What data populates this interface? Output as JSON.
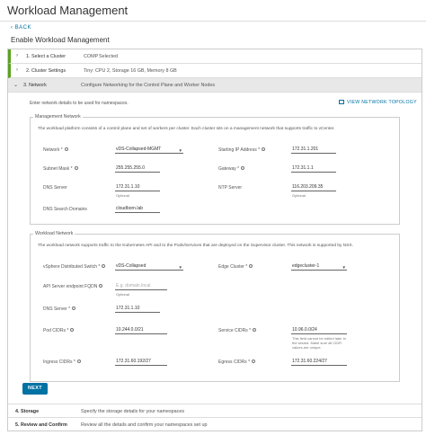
{
  "window": {
    "title": "Workload Management"
  },
  "nav": {
    "back_label": "BACK"
  },
  "page": {
    "title": "Enable Workload Management"
  },
  "steps": [
    {
      "name": "1. Select a Cluster",
      "desc": "COMP",
      "desc2": "Selected",
      "state": "done"
    },
    {
      "name": "2. Cluster Settings",
      "desc": "Tiny: CPU 2, Storage 16 GB, Memory 8 GB",
      "state": "done"
    },
    {
      "name": "3. Network",
      "desc": "Configure Networking for the Control Plane and Worker Nodes",
      "state": "active"
    },
    {
      "name": "4. Storage",
      "desc": "Specify the storage details for your namespaces",
      "state": "pending"
    },
    {
      "name": "5. Review and Confirm",
      "desc": "Review all the details and confirm your namespaces set up",
      "state": "pending"
    }
  ],
  "network": {
    "intro": "Enter network details to be used for namespaces.",
    "topology_link": "VIEW NETWORK TOPOLOGY",
    "management": {
      "legend": "Management Network",
      "description": "The workload platform consists of a control plane and set of workers per cluster. Each cluster sits on a management network that supports traffic to vCenter.",
      "network_label": "Network",
      "network_value": "vDS-Collapsed-MGMT",
      "starting_ip_label": "Starting IP Address",
      "starting_ip_value": "172.31.1.201",
      "subnet_label": "Subnet Mask",
      "subnet_value": "255.255.255.0",
      "gateway_label": "Gateway",
      "gateway_value": "172.31.1.1",
      "dns_label": "DNS Server",
      "dns_value": "172.31.1.10",
      "dns_hint": "Optional",
      "ntp_label": "NTP Server",
      "ntp_value": "116.203.209.35",
      "ntp_hint": "Optional",
      "search_label": "DNS Search Domains",
      "search_value": "cloudborn.lab"
    },
    "workload": {
      "legend": "Workload Network",
      "description": "The workload network supports traffic to the Kubernetes API and to the Pods/Services that are deployed on the Supervisor cluster. This network is supported by NSX.",
      "vds_label": "vSphere Distributed Switch",
      "vds_value": "vDS-Collapsed",
      "edge_label": "Edge Cluster",
      "edge_value": "edgecluster-1",
      "fqdn_label": "API Server endpoint FQDN",
      "fqdn_placeholder": "E.g. domain.local",
      "fqdn_hint": "Optional",
      "dns_label": "DNS Server",
      "dns_value": "172.31.1.10",
      "pod_label": "Pod CIDRs",
      "pod_value": "10.244.0.0/21",
      "service_label": "Service CIDRs",
      "service_value": "10.96.0.0/24",
      "service_hint": "This field cannot be edited later in the wizard. Make sure all CIDR values are unique.",
      "ingress_label": "Ingress CIDRs",
      "ingress_value": "172.31.60.192/27",
      "egress_label": "Egress CIDRs",
      "egress_value": "172.31.60.224/27"
    },
    "next_label": "NEXT"
  }
}
